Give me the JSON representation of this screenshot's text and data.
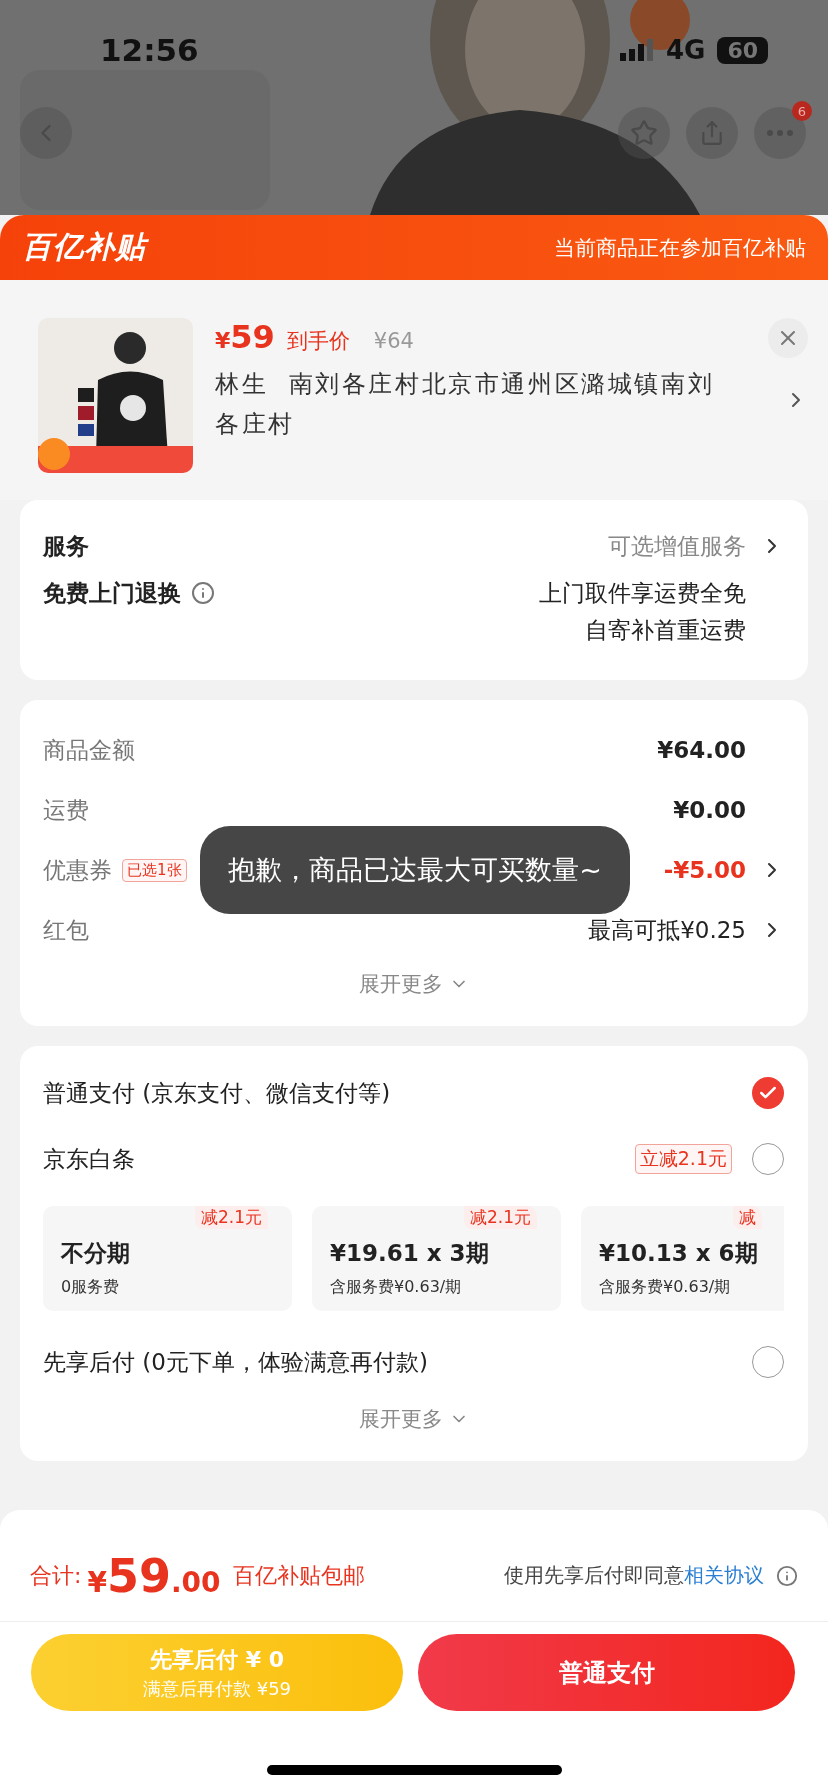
{
  "status_bar": {
    "time": "12:56",
    "network": "4G",
    "battery": "60"
  },
  "nav": {
    "badge": "6"
  },
  "banner": {
    "logo": "百亿补贴",
    "note": "当前商品正在参加百亿补贴"
  },
  "product": {
    "currency": "¥",
    "price": "59",
    "price_label": "到手价",
    "original_price": "¥64",
    "recipient": "林生",
    "address": "南刘各庄村北京市通州区潞城镇南刘各庄村"
  },
  "services": {
    "title": "服务",
    "value": "可选增值服务",
    "free_return": {
      "label": "免费上门退换",
      "lines": [
        "上门取件享运费全免",
        "自寄补首重运费"
      ]
    }
  },
  "fees": {
    "rows": [
      {
        "label": "商品金额",
        "value": "¥64.00",
        "kind": "plain"
      },
      {
        "label": "运费",
        "value": "¥0.00",
        "kind": "plain"
      },
      {
        "label": "优惠券",
        "tag": "已选1张",
        "value": "-¥5.00",
        "kind": "discount"
      },
      {
        "label": "红包",
        "value": "最高可抵¥0.25",
        "kind": "link"
      }
    ],
    "expand": "展开更多"
  },
  "payment": {
    "options": [
      {
        "label": "普通支付 (京东支付、微信支付等)",
        "selected": true
      },
      {
        "label": "京东白条",
        "selected": false,
        "tag": "立减2.1元",
        "installments": [
          {
            "title": "不分期",
            "subtitle": "0服务费",
            "tag": "减2.1元"
          },
          {
            "title": "¥19.61 x 3期",
            "subtitle": "含服务费¥0.63/期",
            "tag": "减2.1元"
          },
          {
            "title": "¥10.13 x 6期",
            "subtitle": "含服务费¥0.63/期",
            "tag": "减"
          }
        ]
      },
      {
        "label": "先享后付 (0元下单，体验满意再付款)",
        "selected": false
      }
    ],
    "expand": "展开更多"
  },
  "footer": {
    "total_label": "合计:",
    "total_currency": "¥",
    "total_int": "59",
    "total_dec": ".00",
    "shipping": "百亿补贴包邮",
    "agreement": "使用先享后付即同意",
    "agreement_link": "相关协议",
    "later_button": {
      "line1": "先享后付 ¥ 0",
      "line2": "满意后再付款 ¥59"
    },
    "pay_button": "普通支付"
  },
  "toast": "抱歉，商品已达最大可买数量~"
}
